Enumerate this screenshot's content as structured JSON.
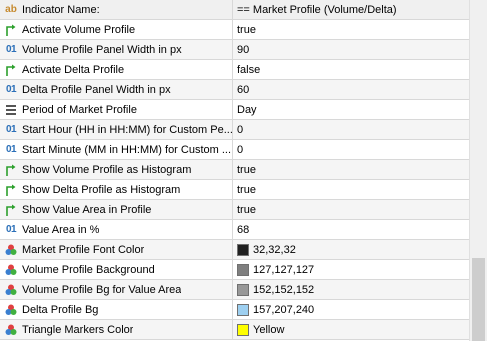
{
  "header": {
    "name_label": "Indicator Name:",
    "value": "== Market Profile (Volume/Delta)"
  },
  "rows": [
    {
      "label": "Activate Volume Profile",
      "value": "true",
      "icon": "bool-arrow-icon"
    },
    {
      "label": "Volume Profile Panel Width in px",
      "value": "90",
      "icon": "number-icon"
    },
    {
      "label": "Activate Delta Profile",
      "value": "false",
      "icon": "bool-arrow-icon"
    },
    {
      "label": "Delta Profile Panel Width in px",
      "value": "60",
      "icon": "number-icon"
    },
    {
      "label": "Period of Market Profile",
      "value": "Day",
      "icon": "enum-list-icon"
    },
    {
      "label": "Start Hour (HH in HH:MM) for Custom Pe...",
      "value": "0",
      "icon": "number-icon"
    },
    {
      "label": "Start Minute (MM in HH:MM) for Custom ...",
      "value": "0",
      "icon": "number-icon"
    },
    {
      "label": "Show Volume Profile as Histogram",
      "value": "true",
      "icon": "bool-arrow-icon"
    },
    {
      "label": "Show Delta Profile as Histogram",
      "value": "true",
      "icon": "bool-arrow-icon"
    },
    {
      "label": "Show Value Area in Profile",
      "value": "true",
      "icon": "bool-arrow-icon"
    },
    {
      "label": "Value Area in %",
      "value": "68",
      "icon": "number-icon"
    },
    {
      "label": "Market Profile Font Color",
      "value": "32,32,32",
      "icon": "palette-icon",
      "swatch": "#202020"
    },
    {
      "label": "Volume Profile Background",
      "value": "127,127,127",
      "icon": "palette-icon",
      "swatch": "#7f7f7f"
    },
    {
      "label": "Volume Profile Bg for Value Area",
      "value": "152,152,152",
      "icon": "palette-icon",
      "swatch": "#989898"
    },
    {
      "label": "Delta Profile Bg",
      "value": "157,207,240",
      "icon": "palette-icon",
      "swatch": "#9dcff0"
    },
    {
      "label": "Triangle Markers Color",
      "value": "Yellow",
      "icon": "palette-icon",
      "swatch": "#ffff00"
    }
  ],
  "icon_glyphs": {
    "string": "ab",
    "number": "01"
  },
  "colors": {
    "header_bg": "#f0f0f0",
    "alt_row_bg": "#f5f5f5",
    "grid_line": "#d8d8d8",
    "bool_icon": "#2ca02c",
    "number_icon": "#2a6fb8"
  }
}
